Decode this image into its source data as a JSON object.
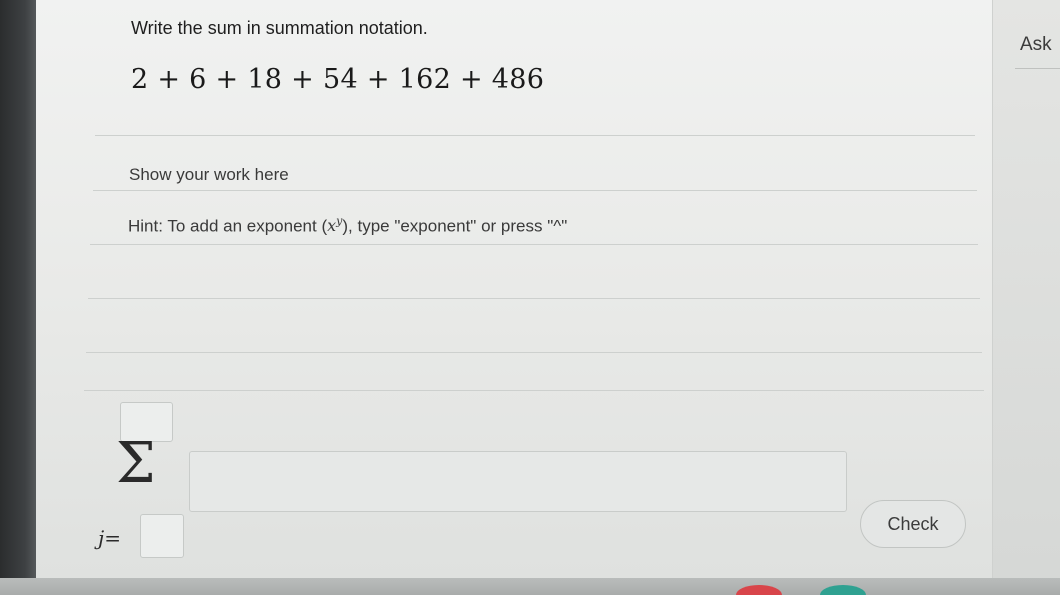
{
  "question": {
    "instruction": "Write the sum in summation notation.",
    "expression": "2 + 6 + 18 + 54 + 162 + 486"
  },
  "sidebar": {
    "ask_label": "Ask"
  },
  "work_area": {
    "label": "Show your work here",
    "hint_prefix": "Hint: To add an exponent (",
    "hint_base": "x",
    "hint_exp": "y",
    "hint_suffix": "), type \"exponent\" or press \"^\""
  },
  "answer": {
    "sigma_symbol": "Σ",
    "index_variable": "j",
    "equals": "=",
    "upper_limit_value": "",
    "lower_limit_value": "",
    "term_value": ""
  },
  "actions": {
    "check_label": "Check"
  },
  "colors": {
    "card_background": "#eeefee",
    "bottom_dot_red": "#d8454a",
    "bottom_dot_teal": "#2fa191"
  }
}
